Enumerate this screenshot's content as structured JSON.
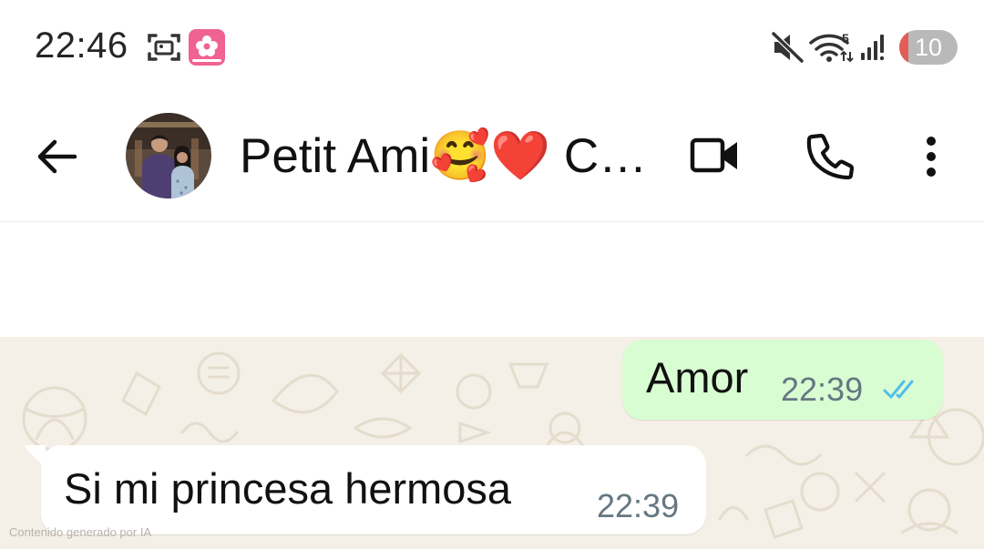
{
  "status_bar": {
    "time": "22:46",
    "wifi_badge": "5",
    "battery_level": "10",
    "battery_fraction": 0.15,
    "icons": [
      "screenshot-icon",
      "app-notification-icon",
      "mute-icon",
      "wifi-icon",
      "signal-icon"
    ]
  },
  "header": {
    "contact_name": "Petit Ami🥰❤️ C…",
    "icons": [
      "back-arrow-icon",
      "avatar",
      "video-call-icon",
      "phone-icon",
      "more-options-icon"
    ]
  },
  "messages": [
    {
      "direction": "outgoing",
      "text": "Amor",
      "time": "22:39",
      "status": "read"
    },
    {
      "direction": "incoming",
      "text": "Si mi princesa hermosa",
      "time": "22:39"
    }
  ],
  "footer": {
    "ai_note": "Contenido generado por IA"
  },
  "colors": {
    "outgoing_bubble": "#d9fdd3",
    "incoming_bubble": "#ffffff",
    "chat_background": "#f4efe7",
    "read_ticks": "#53bdeb",
    "battery_low": "#e35d58"
  }
}
